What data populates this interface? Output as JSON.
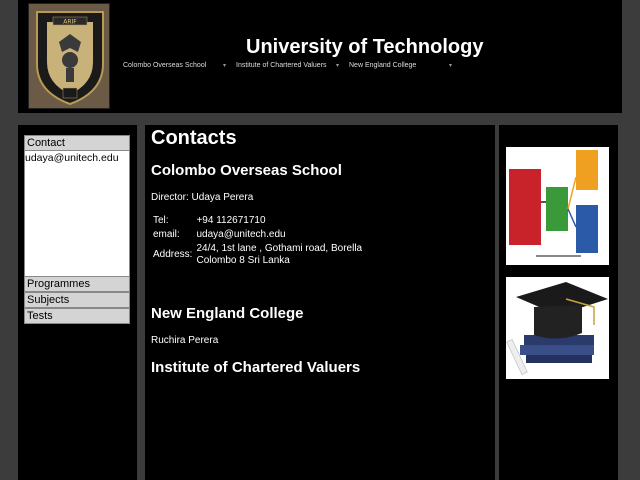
{
  "header": {
    "title": "University of Technology",
    "logo_text": "ARIF"
  },
  "topnav": [
    {
      "label": "Colombo Overseas School",
      "arrow": "▾"
    },
    {
      "label": "Institute of Chartered Valuers",
      "arrow": "▾"
    },
    {
      "label": "New England College",
      "arrow": "▾"
    }
  ],
  "sidebar": {
    "sections": [
      {
        "label": "Contact",
        "content": "udaya@unitech.edu",
        "expanded": true
      },
      {
        "label": "Programmes"
      },
      {
        "label": "Subjects"
      },
      {
        "label": "Tests"
      }
    ]
  },
  "main": {
    "heading": "Contacts",
    "colombo": {
      "name": "Colombo Overseas School",
      "director": "Director: Udaya Perera",
      "rows": [
        {
          "key": "Tel:",
          "value": "+94 112671710"
        },
        {
          "key": "email:",
          "value": "udaya@unitech.edu"
        },
        {
          "key": "Address:",
          "value_line1": "24/4, 1st lane , Gothami road, Borella",
          "value_line2": "Colombo 8 Sri Lanka"
        }
      ]
    },
    "newengland": {
      "name": "New England College",
      "person": "Ruchira Perera"
    },
    "valuers": {
      "name": "Institute of Chartered Valuers"
    }
  },
  "colors": {
    "page_bg": "#3c3c3c",
    "panel_bg": "#000000",
    "accordion_header": "#d4d4d4"
  }
}
